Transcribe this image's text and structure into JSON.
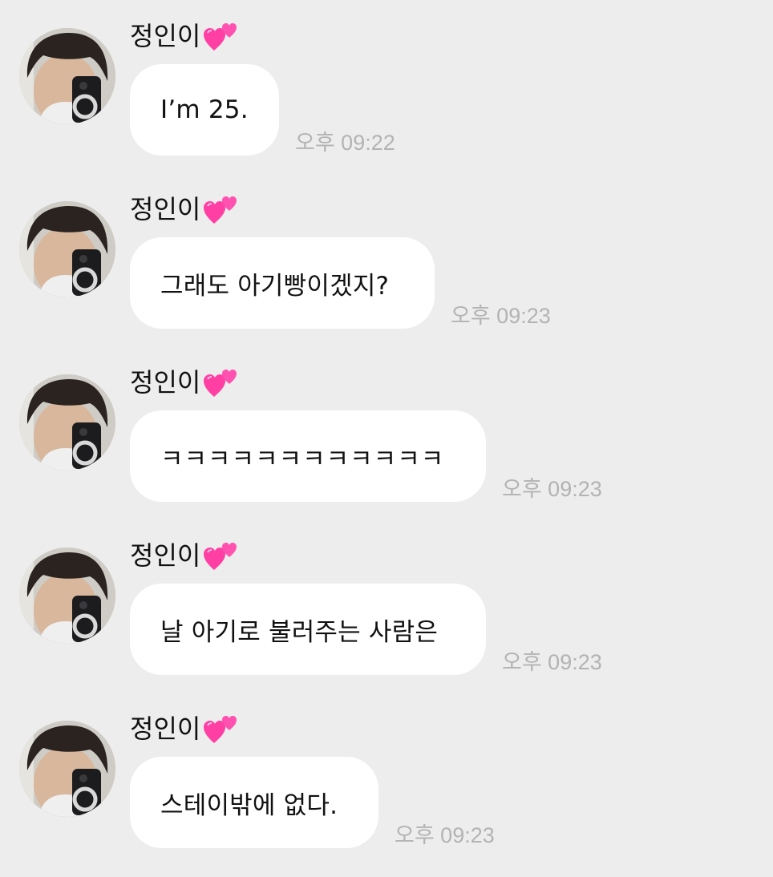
{
  "chat": {
    "accent_heart_color": "#ff3fa4",
    "bubble_color": "#ffffff",
    "background_color": "#ededed",
    "messages": [
      {
        "sender": "정인이",
        "sender_icon": "two-hearts-icon",
        "text": "I’m 25.",
        "time": "오후 09:22"
      },
      {
        "sender": "정인이",
        "sender_icon": "two-hearts-icon",
        "text": "그래도 아기빵이겠지?",
        "time": "오후 09:23"
      },
      {
        "sender": "정인이",
        "sender_icon": "two-hearts-icon",
        "text": "ㅋㅋㅋㅋㅋㅋㅋㅋㅋㅋㅋㅋ",
        "time": "오후 09:23"
      },
      {
        "sender": "정인이",
        "sender_icon": "two-hearts-icon",
        "text": "날 아기로 불러주는 사람은",
        "time": "오후 09:23"
      },
      {
        "sender": "정인이",
        "sender_icon": "two-hearts-icon",
        "text": "스테이밖에 없다.",
        "time": "오후 09:23"
      }
    ]
  }
}
